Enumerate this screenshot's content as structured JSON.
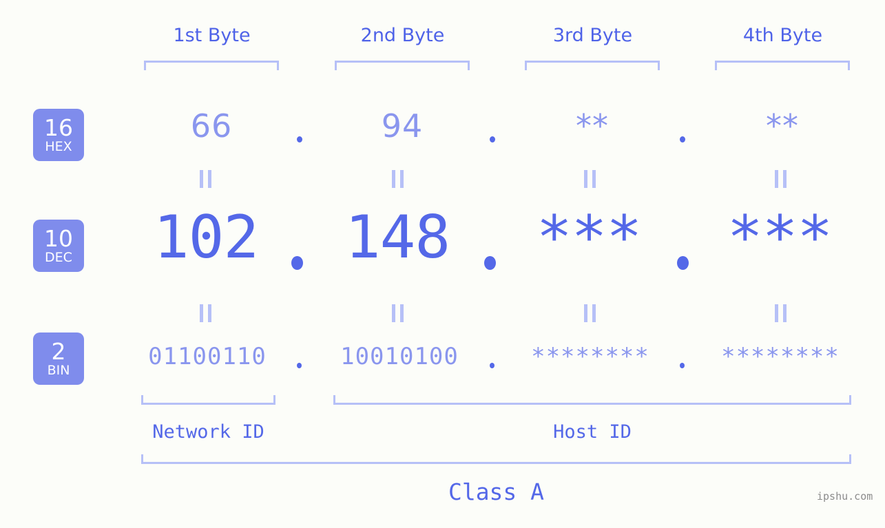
{
  "header": {
    "byte_labels": [
      "1st Byte",
      "2nd Byte",
      "3rd Byte",
      "4th Byte"
    ]
  },
  "rows": [
    {
      "radix": "16",
      "radix_name": "HEX",
      "values": [
        "66",
        "94",
        "**",
        "**"
      ],
      "separator": "."
    },
    {
      "radix": "10",
      "radix_name": "DEC",
      "values": [
        "102",
        "148",
        "***",
        "***"
      ],
      "separator": "."
    },
    {
      "radix": "2",
      "radix_name": "BIN",
      "values": [
        "01100110",
        "10010100",
        "********",
        "********"
      ],
      "separator": "."
    }
  ],
  "equality_mark": "||",
  "footer": {
    "network_id_label": "Network ID",
    "host_id_label": "Host ID",
    "class_label": "Class A",
    "watermark": "ipshu.com"
  },
  "colors": {
    "background": "#fcfdf9",
    "badge_bg": "#7f8cec",
    "badge_text": "#ffffff",
    "accent_strong": "#5468e8",
    "accent_light": "#8a96ee",
    "bracket": "#b6c0f7",
    "header_text": "#4f63e8",
    "watermark_text": "#8c8c8c"
  }
}
